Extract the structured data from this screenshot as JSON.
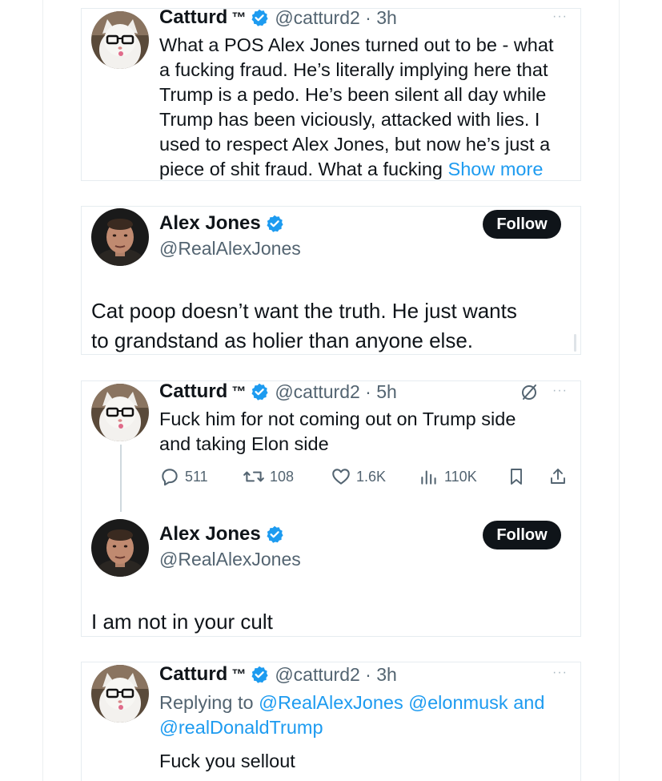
{
  "colors": {
    "accent": "#1d9bf0",
    "text": "#0f1419",
    "muted": "#536471",
    "follow_bg": "#0f1419"
  },
  "icons": [
    "verified-badge-icon",
    "more-dots-icon",
    "reply-icon",
    "retweet-icon",
    "like-icon",
    "views-icon",
    "bookmark-icon",
    "share-icon",
    "no-edit-icon"
  ],
  "tweet1": {
    "name": "Catturd",
    "tm": "™",
    "handle_time": "@catturd2 · 3h",
    "lines": [
      "What a POS Alex Jones turned out to be - what",
      "a fucking fraud.  He’s literally implying here that",
      "Trump is a pedo. He’s been silent all day while",
      "Trump has been viciously, attacked with lies. I",
      "used to respect Alex Jones, but now he’s just a",
      "piece of shit fraud. What a fucking"
    ],
    "show_more": "Show more",
    "more": "···"
  },
  "tweet2": {
    "name": "Alex Jones",
    "handle": "@RealAlexJones",
    "follow": "Follow",
    "lines": [
      "Cat poop doesn’t want the truth. He just wants",
      "to grandstand as holier than anyone else."
    ]
  },
  "tweet3": {
    "name": "Catturd",
    "tm": "™",
    "handle_time": "@catturd2 · 5h",
    "lines": [
      "Fuck him for not coming out on Trump side",
      "and taking Elon side"
    ],
    "more": "···",
    "replies": "511",
    "retweets": "108",
    "likes": "1.6K",
    "views": "110K",
    "reply_name": "Alex Jones",
    "reply_handle": "@RealAlexJones",
    "reply_follow": "Follow",
    "reply_text": "I am not in your cult"
  },
  "tweet4": {
    "name": "Catturd",
    "tm": "™",
    "handle_time": "@catturd2 · 3h",
    "more": "···",
    "replying_prefix": "Replying to",
    "replying_to_1": "@RealAlexJones @elonmusk and",
    "replying_to_2": "@realDonaldTrump",
    "text": "Fuck you sellout"
  }
}
